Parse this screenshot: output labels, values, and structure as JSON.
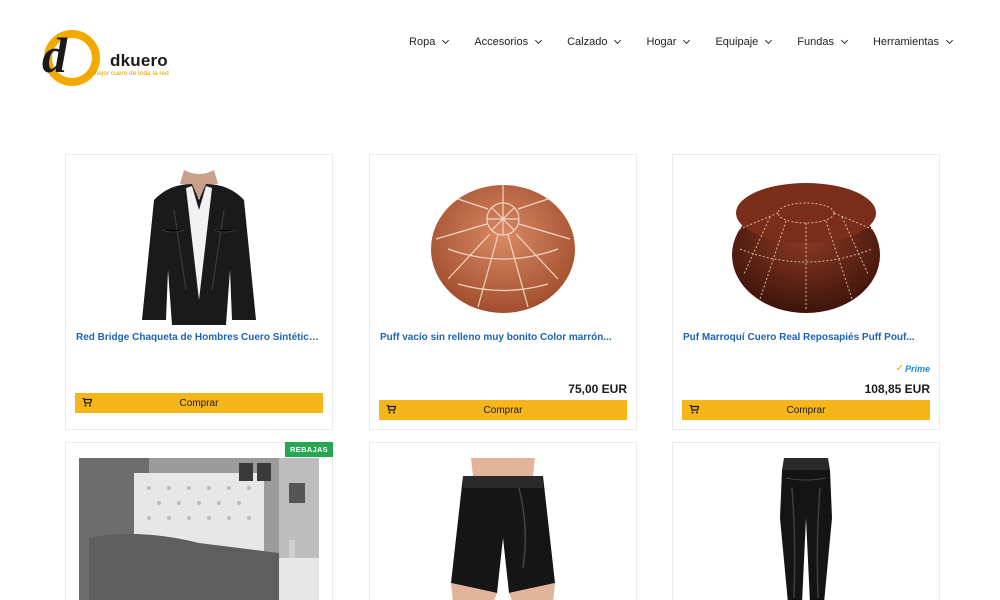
{
  "brand": {
    "name": "dkuero",
    "tagline": "el mejor cuero de toda la red",
    "accent_color": "#f2a900"
  },
  "nav": {
    "items": [
      {
        "label": "Ropa"
      },
      {
        "label": "Accesorios"
      },
      {
        "label": "Calzado"
      },
      {
        "label": "Hogar"
      },
      {
        "label": "Equipaje"
      },
      {
        "label": "Fundas"
      },
      {
        "label": "Herramientas"
      }
    ]
  },
  "products": [
    {
      "title": "Red Bridge Chaqueta de Hombres Cuero Sintética,...",
      "price": "",
      "prime": "",
      "button": "Comprar",
      "image_icon": "leather-jacket-image"
    },
    {
      "title": "Puff vacío sin relleno muy bonito Color marrón...",
      "price": "75,00 EUR",
      "prime": "",
      "button": "Comprar",
      "image_icon": "leather-pouf-image"
    },
    {
      "title": "Puf Marroquí Cuero Real Reposapiés Puff Pouf...",
      "price": "108,85 EUR",
      "prime": "Prime",
      "button": "Comprar",
      "image_icon": "dark-leather-pouf-image"
    },
    {
      "title": "",
      "badge": "REBAJAS",
      "image_icon": "headboard-bedroom-image"
    },
    {
      "title": "",
      "image_icon": "leather-shorts-image"
    },
    {
      "title": "",
      "image_icon": "leather-pants-image"
    }
  ],
  "colors": {
    "link": "#1f63b3",
    "button": "#f6b619",
    "badge": "#27a653",
    "prime": "#1a8ad6"
  }
}
